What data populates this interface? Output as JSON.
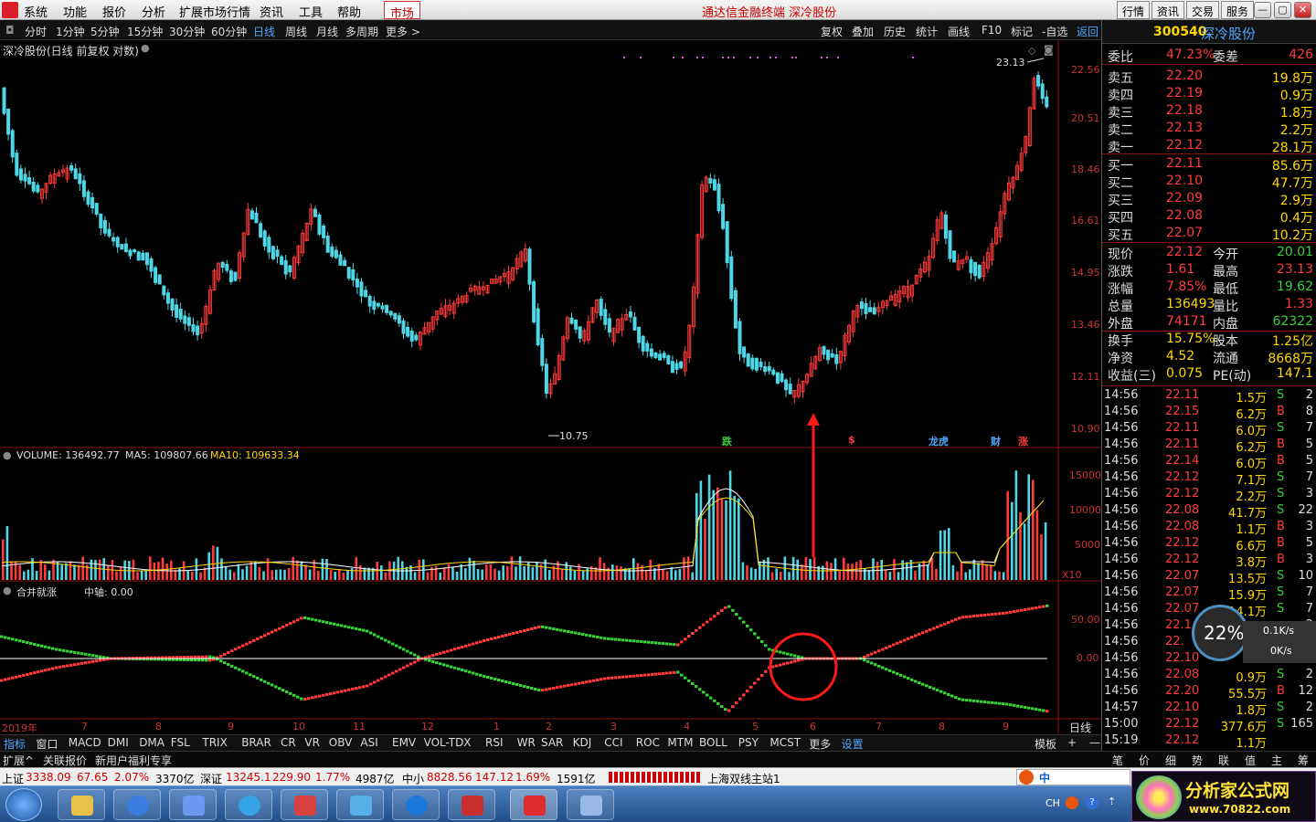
{
  "menubar": {
    "items": [
      "系统",
      "功能",
      "报价",
      "分析",
      "扩展市场行情",
      "资讯",
      "工具",
      "帮助"
    ],
    "market_tab": "市场",
    "title": "通达信金融终端  深冷股份",
    "right_buttons": [
      "行情",
      "资讯",
      "交易",
      "服务"
    ],
    "win_buttons": [
      "—",
      "▢",
      "▭",
      "✕"
    ]
  },
  "periodbar": {
    "periods": [
      "分时",
      "1分钟",
      "5分钟",
      "15分钟",
      "30分钟",
      "60分钟",
      "日线",
      "周线",
      "月线",
      "多周期",
      "更多 >"
    ],
    "active": "日线",
    "right": [
      "复权",
      "叠加",
      "历史",
      "统计",
      "画线",
      "F10",
      "标记",
      "-自选",
      "返回"
    ]
  },
  "main_chart": {
    "title": "深冷股份(日线 前复权 对数)",
    "price_axis": [
      "22.56",
      "20.51",
      "18.46",
      "16.61",
      "14.95",
      "13.46",
      "12.11",
      "10.90"
    ],
    "high_label": "23.13",
    "low_label": "10.75",
    "event_tags": [
      {
        "text": "跌",
        "color": "#37d13a"
      },
      {
        "text": "$",
        "color": "#ff3b3b"
      },
      {
        "text": "龙虎",
        "color": "#4fa7ff"
      },
      {
        "text": "财",
        "color": "#4fa7ff"
      },
      {
        "text": "涨",
        "color": "#ff3b3b"
      }
    ]
  },
  "volume_panel": {
    "label": "VOLUME: 136492.77",
    "ma5": "MA5: 109807.66",
    "ma10": "MA10: 109633.34",
    "axis": [
      "15000",
      "10000",
      "5000",
      "X10"
    ]
  },
  "indicator_panel": {
    "name": "合并就涨",
    "axis_label": "中轴: 0.00",
    "axis": [
      "50.00",
      "0.00"
    ]
  },
  "time_axis": [
    "2019年",
    "7",
    "8",
    "9",
    "10",
    "11",
    "12",
    "1",
    "2",
    "3",
    "4",
    "5",
    "6",
    "7",
    "8",
    "9"
  ],
  "period_label": "日线",
  "quote": {
    "code": "300540",
    "name": "深冷股份",
    "ratio": {
      "label": "委比",
      "value": "47.23%",
      "diff_label": "委差",
      "diff": "426"
    },
    "asks": [
      {
        "label": "卖五",
        "price": "22.20",
        "vol": "19.8万"
      },
      {
        "label": "卖四",
        "price": "22.19",
        "vol": "0.9万"
      },
      {
        "label": "卖三",
        "price": "22.18",
        "vol": "1.8万"
      },
      {
        "label": "卖二",
        "price": "22.13",
        "vol": "2.2万"
      },
      {
        "label": "卖一",
        "price": "22.12",
        "vol": "28.1万"
      }
    ],
    "bids": [
      {
        "label": "买一",
        "price": "22.11",
        "vol": "85.6万"
      },
      {
        "label": "买二",
        "price": "22.10",
        "vol": "47.7万"
      },
      {
        "label": "买三",
        "price": "22.09",
        "vol": "2.9万"
      },
      {
        "label": "买四",
        "price": "22.08",
        "vol": "0.4万"
      },
      {
        "label": "买五",
        "price": "22.07",
        "vol": "10.2万"
      }
    ],
    "stats": [
      {
        "l1": "现价",
        "v1": "22.12",
        "l2": "今开",
        "v2": "20.01",
        "c1": "#ff3b3b",
        "c2": "#37d13a"
      },
      {
        "l1": "涨跌",
        "v1": "1.61",
        "l2": "最高",
        "v2": "23.13",
        "c1": "#ff3b3b",
        "c2": "#ff3b3b"
      },
      {
        "l1": "涨幅",
        "v1": "7.85%",
        "l2": "最低",
        "v2": "19.62",
        "c1": "#ff3b3b",
        "c2": "#37d13a"
      },
      {
        "l1": "总量",
        "v1": "136493",
        "l2": "量比",
        "v2": "1.33",
        "c1": "#ffd700",
        "c2": "#ff3b3b"
      },
      {
        "l1": "外盘",
        "v1": "74171",
        "l2": "内盘",
        "v2": "62322",
        "c1": "#ff3b3b",
        "c2": "#37d13a"
      },
      {
        "l1": "换手",
        "v1": "15.75%",
        "l2": "股本",
        "v2": "1.25亿",
        "c1": "#ffd700",
        "c2": "#ffd700"
      },
      {
        "l1": "净资",
        "v1": "4.52",
        "l2": "流通",
        "v2": "8668万",
        "c1": "#ffd700",
        "c2": "#ffd700"
      },
      {
        "l1": "收益(三)",
        "v1": "0.075",
        "l2": "PE(动)",
        "v2": "147.1",
        "c1": "#ffd700",
        "c2": "#ffd700"
      }
    ]
  },
  "ticks": [
    {
      "t": "14:56",
      "p": "22.11",
      "v": "1.5万",
      "d": "S",
      "n": "2",
      "pc": "#ff3b3b"
    },
    {
      "t": "14:56",
      "p": "22.15",
      "v": "6.2万",
      "d": "B",
      "n": "8",
      "pc": "#ff3b3b"
    },
    {
      "t": "14:56",
      "p": "22.11",
      "v": "6.0万",
      "d": "S",
      "n": "7",
      "pc": "#ff3b3b"
    },
    {
      "t": "14:56",
      "p": "22.11",
      "v": "6.2万",
      "d": "B",
      "n": "5",
      "pc": "#ff3b3b"
    },
    {
      "t": "14:56",
      "p": "22.14",
      "v": "6.0万",
      "d": "B",
      "n": "5",
      "pc": "#ff3b3b"
    },
    {
      "t": "14:56",
      "p": "22.12",
      "v": "7.1万",
      "d": "S",
      "n": "7",
      "pc": "#ff3b3b"
    },
    {
      "t": "14:56",
      "p": "22.12",
      "v": "2.2万",
      "d": "S",
      "n": "3",
      "pc": "#ff3b3b"
    },
    {
      "t": "14:56",
      "p": "22.08",
      "v": "41.7万",
      "d": "S",
      "n": "22",
      "pc": "#ff3b3b"
    },
    {
      "t": "14:56",
      "p": "22.08",
      "v": "1.1万",
      "d": "B",
      "n": "3",
      "pc": "#ff3b3b"
    },
    {
      "t": "14:56",
      "p": "22.12",
      "v": "6.6万",
      "d": "B",
      "n": "5",
      "pc": "#ff3b3b"
    },
    {
      "t": "14:56",
      "p": "22.12",
      "v": "3.8万",
      "d": "B",
      "n": "3",
      "pc": "#ff3b3b"
    },
    {
      "t": "14:56",
      "p": "22.07",
      "v": "13.5万",
      "d": "S",
      "n": "10",
      "pc": "#ff3b3b"
    },
    {
      "t": "14:56",
      "p": "22.07",
      "v": "15.9万",
      "d": "S",
      "n": "7",
      "pc": "#ff3b3b"
    },
    {
      "t": "14:56",
      "p": "22.07",
      "v": "14.1万",
      "d": "S",
      "n": "7",
      "pc": "#ff3b3b"
    },
    {
      "t": "14:56",
      "p": "22.1",
      "v": "",
      "d": "",
      "n": "2",
      "pc": "#ff3b3b"
    },
    {
      "t": "14:56",
      "p": "22.",
      "v": "",
      "d": "",
      "n": "3",
      "pc": "#ff3b3b"
    },
    {
      "t": "14:56",
      "p": "22.10",
      "v": "13.",
      "d": "",
      "n": "2",
      "pc": "#ff3b3b"
    },
    {
      "t": "14:56",
      "p": "22.08",
      "v": "0.9万",
      "d": "S",
      "n": "2",
      "pc": "#ff3b3b"
    },
    {
      "t": "14:56",
      "p": "22.20",
      "v": "55.5万",
      "d": "B",
      "n": "12",
      "pc": "#ff3b3b"
    },
    {
      "t": "14:57",
      "p": "22.10",
      "v": "1.8万",
      "d": "S",
      "n": "2",
      "pc": "#ff3b3b"
    },
    {
      "t": "15:00",
      "p": "22.12",
      "v": "377.6万",
      "d": "S",
      "n": "165",
      "pc": "#ff3b3b"
    },
    {
      "t": "15:19",
      "p": "22.12",
      "v": "1.1万",
      "d": "",
      "n": "",
      "pc": "#ff3b3b"
    }
  ],
  "net_widget": {
    "percent": "22%",
    "up": "0.1K/s",
    "down": "0K/s"
  },
  "indbar": {
    "items": [
      "指标",
      "窗口",
      "MACD",
      "DMI",
      "DMA",
      "FSL",
      "TRIX",
      "BRAR",
      "CR",
      "VR",
      "OBV",
      "ASI",
      "EMV",
      "VOL-TDX",
      "RSI",
      "WR",
      "SAR",
      "KDJ",
      "CCI",
      "ROC",
      "MTM",
      "BOLL",
      "PSY",
      "MCST",
      "更多",
      "设置"
    ],
    "right": [
      "模板",
      "+",
      "—"
    ]
  },
  "extbar": {
    "items": [
      "扩展^",
      "关联报价",
      "新用户福利专享"
    ],
    "right_tabs": [
      "笔",
      "价",
      "细",
      "势",
      "联",
      "值",
      "主",
      "筹"
    ]
  },
  "statusbar": {
    "sh": {
      "name": "上证",
      "val": "3338.09",
      "chg": "67.65",
      "pct": "2.07%",
      "amt": "3370亿"
    },
    "sz": {
      "name": "深证",
      "val": "13245.1",
      "chg": "229.90",
      "pct": "1.77%",
      "amt": "4987亿"
    },
    "zx": {
      "name": "中小",
      "val": "8828.56",
      "chg": "147.12",
      "pct": "1.69%",
      "amt": "1591亿"
    },
    "station": "上海双线主站1",
    "ime": "中"
  },
  "watermark": {
    "title": "分析家公式网",
    "url": "www.70822.com"
  },
  "taskbar": {
    "lang": "CH"
  }
}
